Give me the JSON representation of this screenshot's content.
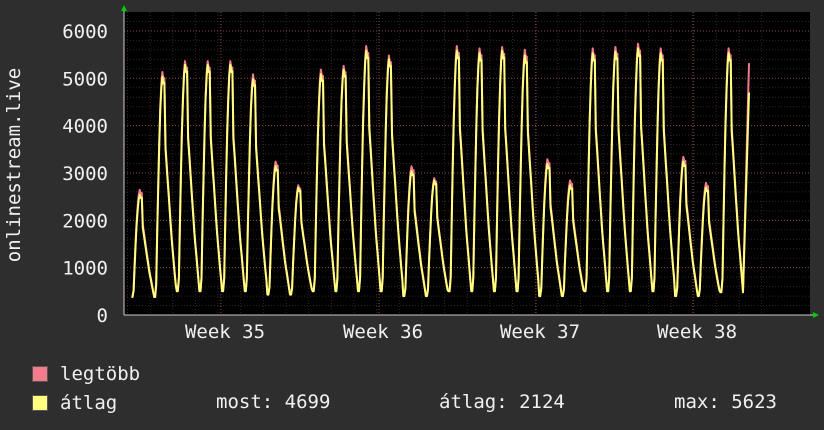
{
  "colors": {
    "background": "#2e2e2e",
    "plot_background": "#000000",
    "grid": "#5a3a3a",
    "max_series": "#f37b8b",
    "avg_series": "#ffff80",
    "text": "#f0f0f0",
    "arrow": "#00cc00"
  },
  "legend": {
    "max_label": "legtöbb",
    "avg_label": "átlag",
    "now_text": "most: 4699",
    "avg_text": "átlag: 2124",
    "max_text": "max: 5623"
  },
  "chart_data": {
    "type": "line",
    "ylabel": "onlinestream.live",
    "ylim": [
      0,
      6400
    ],
    "yticks": [
      0,
      1000,
      2000,
      3000,
      4000,
      5000,
      6000
    ],
    "x_tick_labels": [
      "Week 35",
      "Week 36",
      "Week 37",
      "Week 38"
    ],
    "grid": true,
    "series": [
      {
        "name": "legtöbb",
        "color": "#f37b8b",
        "daily_peaks": [
          2650,
          5150,
          5380,
          5380,
          5380,
          5100,
          3250,
          2750,
          5200,
          5280,
          5700,
          5500,
          3150,
          2900,
          5700,
          5650,
          5680,
          5620,
          3300,
          2850,
          5650,
          5680,
          5750,
          5650,
          3350,
          2800,
          5650
        ],
        "daily_troughs": [
          400,
          400,
          520,
          520,
          520,
          520,
          450,
          450,
          520,
          520,
          520,
          520,
          420,
          420,
          520,
          520,
          520,
          520,
          420,
          420,
          520,
          520,
          520,
          520,
          420,
          420,
          500
        ],
        "current": 5320
      },
      {
        "name": "átlag",
        "color": "#ffff80",
        "daily_peaks": [
          2550,
          5050,
          5300,
          5300,
          5300,
          5000,
          3150,
          2700,
          5100,
          5200,
          5600,
          5420,
          3050,
          2850,
          5600,
          5550,
          5600,
          5500,
          3200,
          2750,
          5550,
          5580,
          5650,
          5550,
          3250,
          2700,
          5550
        ],
        "daily_troughs": [
          380,
          380,
          500,
          500,
          500,
          500,
          430,
          430,
          500,
          500,
          500,
          500,
          400,
          400,
          500,
          500,
          500,
          500,
          400,
          400,
          500,
          500,
          500,
          500,
          400,
          400,
          480
        ],
        "current": 4699
      }
    ]
  }
}
